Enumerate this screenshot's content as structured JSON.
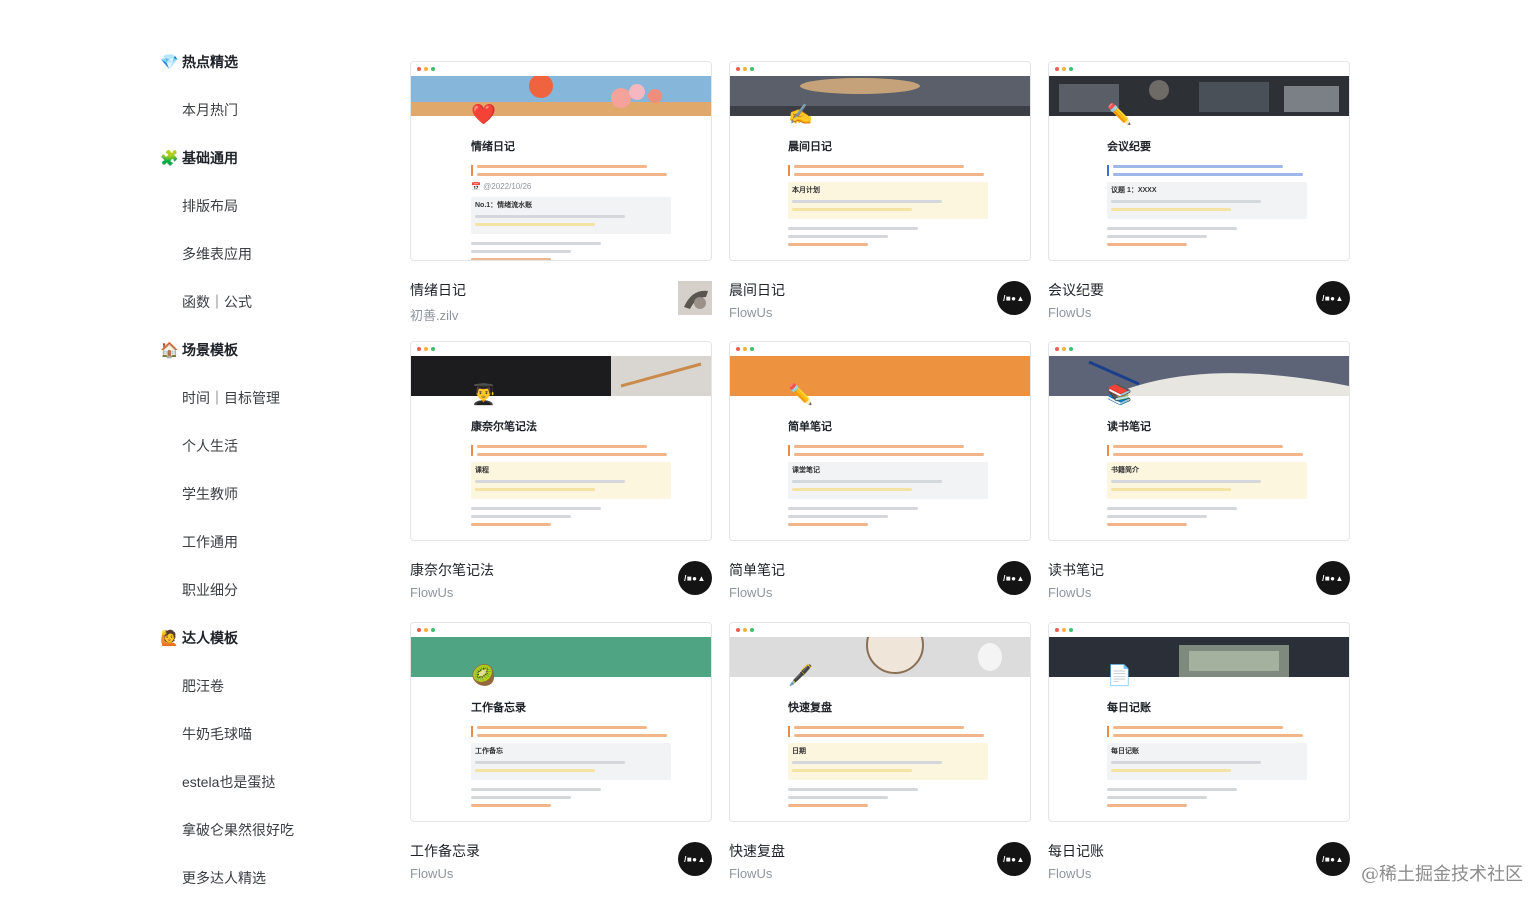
{
  "sidebar": [
    {
      "kind": "group",
      "emoji": "💎",
      "label": "热点精选"
    },
    {
      "kind": "item",
      "label": "本月热门"
    },
    {
      "kind": "group",
      "emoji": "🧩",
      "label": "基础通用"
    },
    {
      "kind": "item",
      "label": "排版布局"
    },
    {
      "kind": "item",
      "label": "多维表应用"
    },
    {
      "kind": "item",
      "label": "函数｜公式"
    },
    {
      "kind": "group",
      "emoji": "🏠",
      "label": "场景模板"
    },
    {
      "kind": "item",
      "label": "时间｜目标管理"
    },
    {
      "kind": "item",
      "label": "个人生活"
    },
    {
      "kind": "item",
      "label": "学生教师"
    },
    {
      "kind": "item",
      "label": "工作通用"
    },
    {
      "kind": "item",
      "label": "职业细分"
    },
    {
      "kind": "group",
      "emoji": "🙋",
      "label": "达人模板"
    },
    {
      "kind": "item",
      "label": "肥汪卷"
    },
    {
      "kind": "item",
      "label": "牛奶毛球喵"
    },
    {
      "kind": "item",
      "label": "estela也是蛋挞"
    },
    {
      "kind": "item",
      "label": "拿破仑果然很好吃"
    },
    {
      "kind": "item",
      "label": "更多达人精选"
    }
  ],
  "cards": [
    {
      "title": "情绪日记",
      "author": "初善.zilv",
      "avatar": "photo",
      "preview_title": "情绪日记",
      "preview_emoji": "❤️",
      "preview_date": "📅 @2022/10/26",
      "preview_section": "No.1：情绪流水账",
      "cover": "sky"
    },
    {
      "title": "晨间日记",
      "author": "FlowUs",
      "avatar": "logo",
      "preview_title": "晨间日记",
      "preview_emoji": "✍️",
      "preview_section": "本月计划",
      "cover": "dusk"
    },
    {
      "title": "会议纪要",
      "author": "FlowUs",
      "avatar": "logo",
      "preview_title": "会议纪要",
      "preview_emoji": "✏️",
      "preview_section": "议题 1：XXXX",
      "cover": "office"
    },
    {
      "title": "康奈尔笔记法",
      "author": "FlowUs",
      "avatar": "logo",
      "preview_title": "康奈尔笔记法",
      "preview_emoji": "👨‍🎓",
      "preview_section": "课程",
      "cover": "pencil"
    },
    {
      "title": "简单笔记",
      "author": "FlowUs",
      "avatar": "logo",
      "preview_title": "简单笔记",
      "preview_emoji": "✏️",
      "preview_section": "课堂笔记",
      "cover": "orange"
    },
    {
      "title": "读书笔记",
      "author": "FlowUs",
      "avatar": "logo",
      "preview_title": "读书笔记",
      "preview_emoji": "📚",
      "preview_section": "书籍简介",
      "cover": "book"
    },
    {
      "title": "工作备忘录",
      "author": "FlowUs",
      "avatar": "logo",
      "preview_title": "工作备忘录",
      "preview_emoji": "🥝",
      "preview_section": "工作备忘",
      "cover": "green"
    },
    {
      "title": "快速复盘",
      "author": "FlowUs",
      "avatar": "logo",
      "preview_title": "快速复盘",
      "preview_emoji": "🖋️",
      "preview_section": "日期",
      "cover": "clock"
    },
    {
      "title": "每日记账",
      "author": "FlowUs",
      "avatar": "logo",
      "preview_title": "每日记账",
      "preview_emoji": "📄",
      "preview_section": "每日记账",
      "cover": "money"
    }
  ],
  "logo_text": "/■●▲",
  "watermark": "@稀土掘金技术社区",
  "colors": {
    "accent_orange": "#f08a42",
    "accent_blue": "#3b6fd9",
    "logo_bg": "#141414",
    "muted": "#8f959e"
  }
}
